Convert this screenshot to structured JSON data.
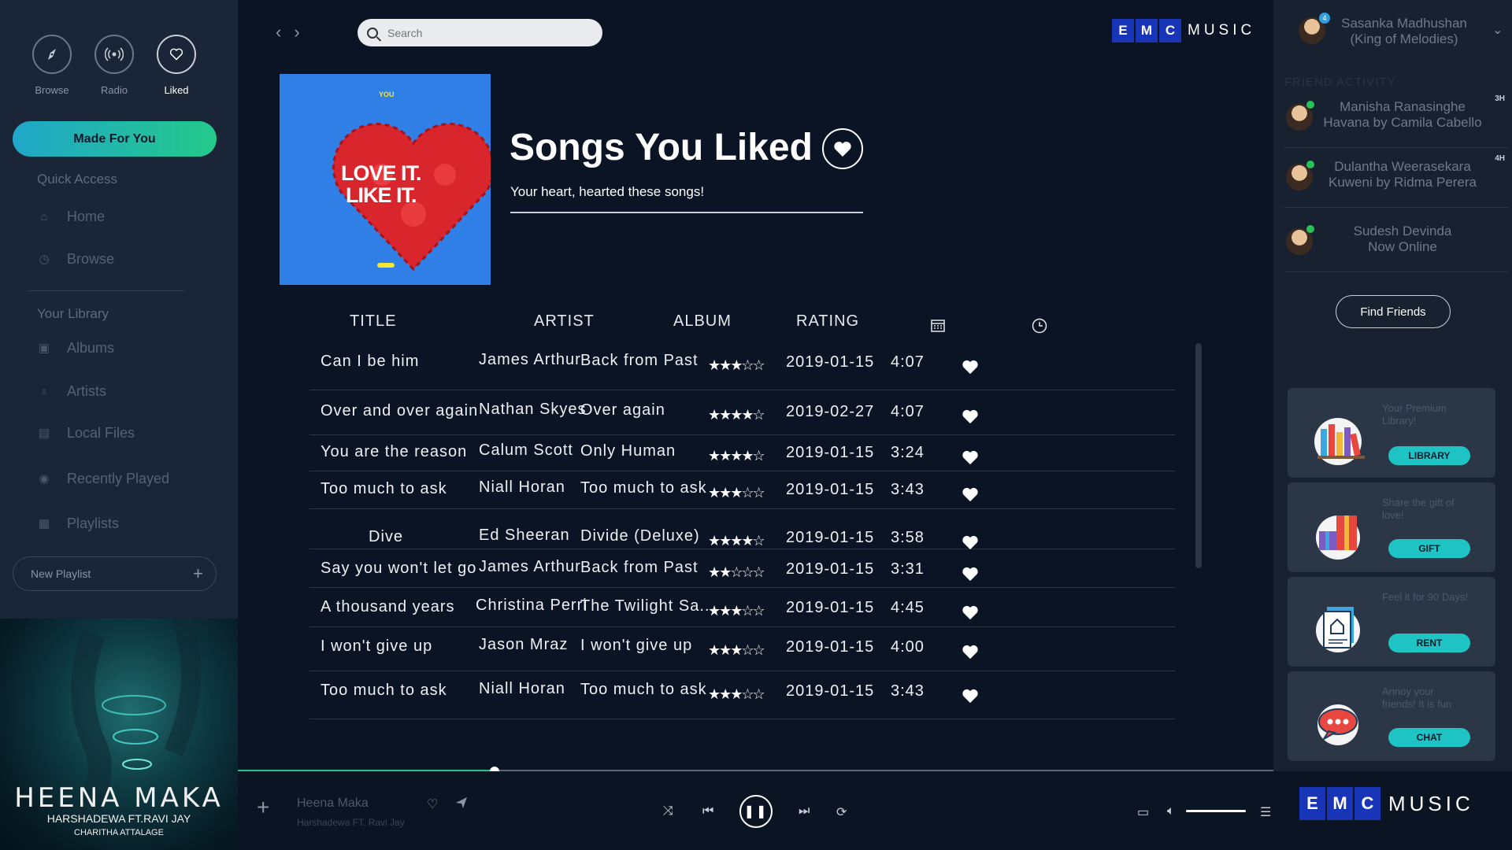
{
  "sidebar": {
    "top_icons": [
      {
        "label": "Browse",
        "icon": "compass-icon"
      },
      {
        "label": "Radio",
        "icon": "radio-icon"
      },
      {
        "label": "Liked",
        "icon": "heart-icon"
      }
    ],
    "made_for_you": "Made For You",
    "quick_access": "Quick Access",
    "quick_items": [
      {
        "label": "Home",
        "icon": "home-icon"
      },
      {
        "label": "Browse",
        "icon": "clock-icon"
      }
    ],
    "library_label": "Your Library",
    "library_items": [
      {
        "label": "Albums",
        "icon": "album-icon"
      },
      {
        "label": "Artists",
        "icon": "microphone-icon"
      },
      {
        "label": "Local Files",
        "icon": "folder-icon"
      },
      {
        "label": "Recently Played",
        "icon": "location-icon"
      },
      {
        "label": "Playlists",
        "icon": "playlist-icon"
      }
    ],
    "new_playlist": "New Playlist"
  },
  "album_art": {
    "title": "HEENA MAKA",
    "artists": "HARSHADEWA FT.RAVI JAY",
    "credit": "CHARITHA ATTALAGE"
  },
  "header": {
    "search_placeholder": "Search",
    "brand_letters": [
      "E",
      "M",
      "C"
    ],
    "brand_word": "MUSIC"
  },
  "playlist": {
    "cover_tag": "YOU",
    "cover_line1": "LOVE IT.",
    "cover_line2": "LIKE IT.",
    "title": "Songs You Liked",
    "subtitle": "Your heart, hearted these songs!"
  },
  "table": {
    "columns": [
      "TITLE",
      "ARTIST",
      "ALBUM",
      "RATING"
    ],
    "icon_columns": [
      "calendar-icon",
      "clock-icon"
    ],
    "rows": [
      {
        "title": "Can I be him",
        "artist": "James Arthur",
        "album": "Back from Past",
        "rating": 3,
        "date": "2019-01-15",
        "duration": "4:07"
      },
      {
        "title": "Over and over again",
        "artist": "Nathan Skyes",
        "album": "Over again",
        "rating": 4,
        "date": "2019-02-27",
        "duration": "4:07"
      },
      {
        "title": "You are the reason",
        "artist": "Calum Scott",
        "album": "Only Human",
        "rating": 4,
        "date": "2019-01-15",
        "duration": "3:24"
      },
      {
        "title": "Too much to ask",
        "artist": "Niall Horan",
        "album": "Too much to ask",
        "rating": 3,
        "date": "2019-01-15",
        "duration": "3:43"
      },
      {
        "title": "Dive",
        "artist": "Ed Sheeran",
        "album": "Divide (Deluxe)",
        "rating": 4,
        "date": "2019-01-15",
        "duration": "3:58"
      },
      {
        "title": "Say you won't let go",
        "artist": "James Arthur",
        "album": "Back from Past",
        "rating": 2,
        "date": "2019-01-15",
        "duration": "3:31"
      },
      {
        "title": "A thousand years",
        "artist": "Christina Perri",
        "album": "The Twilight Sa...",
        "rating": 3,
        "date": "2019-01-15",
        "duration": "4:45"
      },
      {
        "title": "I won't give up",
        "artist": "Jason Mraz",
        "album": "I won't give up",
        "rating": 3,
        "date": "2019-01-15",
        "duration": "4:00"
      },
      {
        "title": "Too much to ask",
        "artist": "Niall Horan",
        "album": "Too much to ask",
        "rating": 3,
        "date": "2019-01-15",
        "duration": "3:43"
      }
    ]
  },
  "progress": {
    "fraction": 0.248
  },
  "right": {
    "profile_line1": "Sasanka Madhushan",
    "profile_line2": "(King of Melodies)",
    "notification_count": "4",
    "friend_activity": "FRIEND ACTIVITY",
    "friends": [
      {
        "line1": "Manisha Ranasinghe",
        "line2": "Havana by Camila Cabello",
        "time": "3H"
      },
      {
        "line1": "Dulantha Weerasekara",
        "line2": "Kuweni by Ridma Perera",
        "time": "4H"
      },
      {
        "line1": "Sudesh Devinda",
        "line2": "Now Online",
        "time": ""
      }
    ],
    "find_friends": "Find Friends",
    "cards": [
      {
        "text": "Your Premium Library!",
        "button": "LIBRARY"
      },
      {
        "text": "Share the gift of love!",
        "button": "GIFT"
      },
      {
        "text": "Feel it for 90 Days!",
        "button": "RENT"
      },
      {
        "text": "Annoy your friends! It is fun",
        "button": "CHAT"
      }
    ]
  },
  "player": {
    "track_title": "Heena Maka",
    "track_artist": "Harshadewa FT. Ravi Jay",
    "volume": 1.0
  },
  "colors": {
    "accent": "#1ec38c",
    "brand_blue": "#1835b8",
    "bg": "#0a1424"
  }
}
